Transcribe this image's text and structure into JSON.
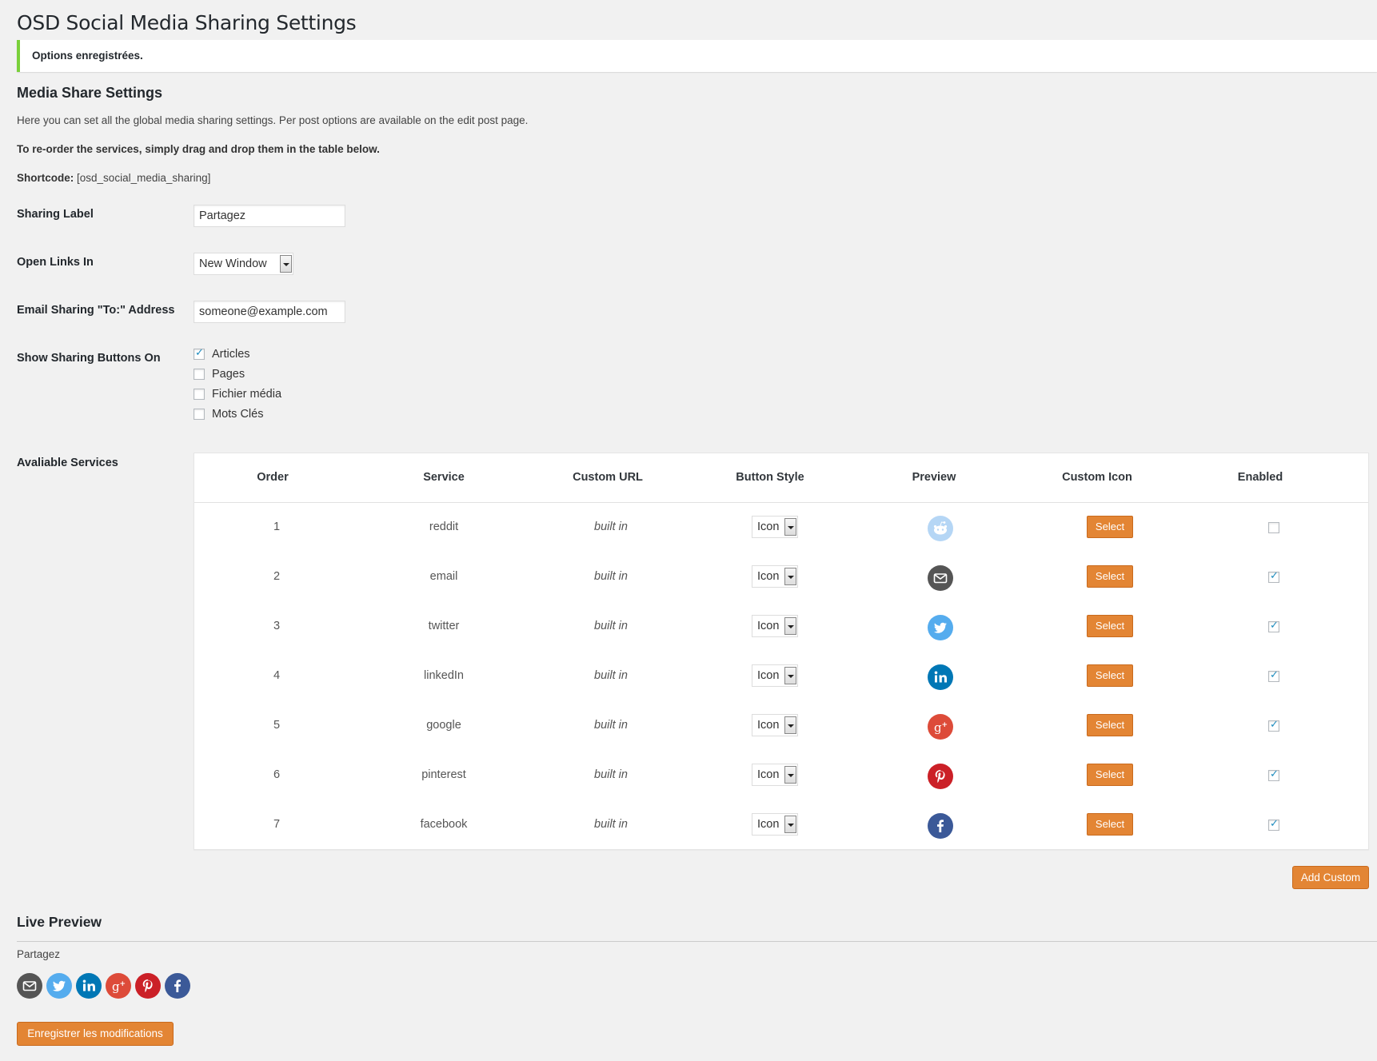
{
  "page_title": "OSD Social Media Sharing Settings",
  "notice": "Options enregistrées.",
  "section_title": "Media Share Settings",
  "intro_text": "Here you can set all the global media sharing settings. Per post options are available on the edit post page.",
  "reorder_text": "To re-order the services, simply drag and drop them in the table below.",
  "shortcode_label": "Shortcode:",
  "shortcode_value": "[osd_social_media_sharing]",
  "fields": {
    "sharing_label": {
      "label": "Sharing Label",
      "value": "Partagez"
    },
    "open_links": {
      "label": "Open Links In",
      "value": "New Window"
    },
    "email_to": {
      "label": "Email Sharing \"To:\" Address",
      "value": "someone@example.com"
    },
    "show_on": {
      "label": "Show Sharing Buttons On"
    },
    "services": {
      "label": "Avaliable Services"
    }
  },
  "show_on_options": [
    {
      "label": "Articles",
      "checked": true
    },
    {
      "label": "Pages",
      "checked": false
    },
    {
      "label": "Fichier média",
      "checked": false
    },
    {
      "label": "Mots Clés",
      "checked": false
    }
  ],
  "table": {
    "headers": [
      "Order",
      "Service",
      "Custom URL",
      "Button Style",
      "Preview",
      "Custom Icon",
      "Enabled"
    ],
    "rows": [
      {
        "order": "1",
        "service": "reddit",
        "url": "built in",
        "style": "Icon",
        "icon": "reddit-icon",
        "color": "#b5d6f5",
        "button": "Select",
        "enabled": false
      },
      {
        "order": "2",
        "service": "email",
        "url": "built in",
        "style": "Icon",
        "icon": "email-icon",
        "color": "#555555",
        "button": "Select",
        "enabled": true
      },
      {
        "order": "3",
        "service": "twitter",
        "url": "built in",
        "style": "Icon",
        "icon": "twitter-icon",
        "color": "#55acee",
        "button": "Select",
        "enabled": true
      },
      {
        "order": "4",
        "service": "linkedIn",
        "url": "built in",
        "style": "Icon",
        "icon": "linkedin-icon",
        "color": "#0077b5",
        "button": "Select",
        "enabled": true
      },
      {
        "order": "5",
        "service": "google",
        "url": "built in",
        "style": "Icon",
        "icon": "google-plus-icon",
        "color": "#dd4b39",
        "button": "Select",
        "enabled": true
      },
      {
        "order": "6",
        "service": "pinterest",
        "url": "built in",
        "style": "Icon",
        "icon": "pinterest-icon",
        "color": "#cb2027",
        "button": "Select",
        "enabled": true
      },
      {
        "order": "7",
        "service": "facebook",
        "url": "built in",
        "style": "Icon",
        "icon": "facebook-icon",
        "color": "#3b5998",
        "button": "Select",
        "enabled": true
      }
    ]
  },
  "add_custom": "Add Custom",
  "live_preview_title": "Live Preview",
  "live_preview_label": "Partagez",
  "live_icons": [
    {
      "icon": "email-icon",
      "color": "#555555"
    },
    {
      "icon": "twitter-icon",
      "color": "#55acee"
    },
    {
      "icon": "linkedin-icon",
      "color": "#0077b5"
    },
    {
      "icon": "google-plus-icon",
      "color": "#dd4b39"
    },
    {
      "icon": "pinterest-icon",
      "color": "#cb2027"
    },
    {
      "icon": "facebook-icon",
      "color": "#3b5998"
    }
  ],
  "save_button": "Enregistrer les modifications"
}
